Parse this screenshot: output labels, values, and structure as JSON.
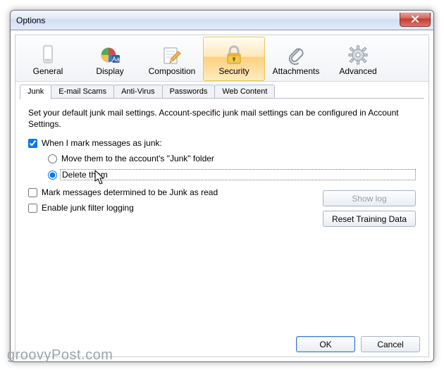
{
  "window": {
    "title": "Options"
  },
  "categories": {
    "general": {
      "label": "General"
    },
    "display": {
      "label": "Display"
    },
    "composition": {
      "label": "Composition"
    },
    "security": {
      "label": "Security"
    },
    "attachments": {
      "label": "Attachments"
    },
    "advanced": {
      "label": "Advanced"
    }
  },
  "tabs": {
    "junk": {
      "label": "Junk"
    },
    "email_scams": {
      "label": "E-mail Scams"
    },
    "anti_virus": {
      "label": "Anti-Virus"
    },
    "passwords": {
      "label": "Passwords"
    },
    "web_content": {
      "label": "Web Content"
    }
  },
  "junk_panel": {
    "description": "Set your default junk mail settings. Account-specific junk mail settings can be configured in Account Settings.",
    "mark_junk_label": "When I mark messages as junk:",
    "move_label": "Move them to the account's \"Junk\" folder",
    "delete_label": "Delete them",
    "mark_read_label": "Mark messages determined to be Junk as read",
    "enable_logging_label": "Enable junk filter logging",
    "show_log_label": "Show log",
    "reset_label": "Reset Training Data",
    "state": {
      "mark_junk_checked": true,
      "action": "delete",
      "mark_read_checked": false,
      "enable_logging_checked": false
    }
  },
  "footer": {
    "ok": "OK",
    "cancel": "Cancel"
  },
  "watermark": "groovyPost.com"
}
